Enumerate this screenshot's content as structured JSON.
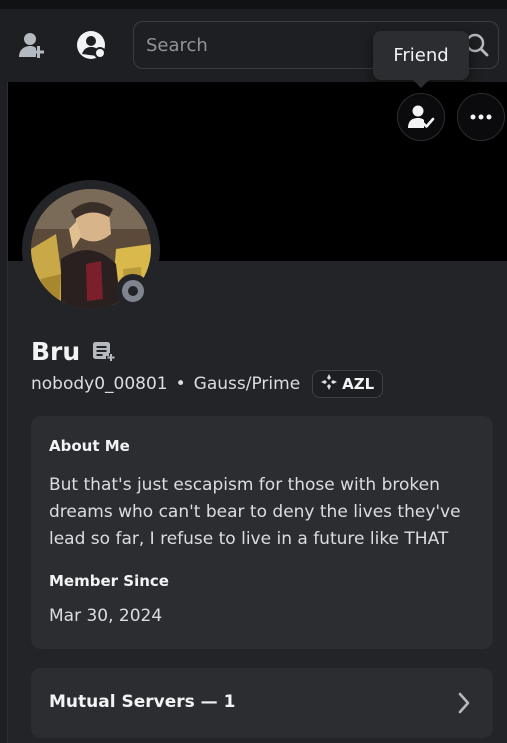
{
  "topbar": {
    "search_placeholder": "Search"
  },
  "tooltip": {
    "text": "Friend"
  },
  "profile": {
    "display_name": "Bru",
    "username": "nobody0_00801",
    "pronouns": "Gauss/Prime",
    "guild_tag": "AZL",
    "status": "offline",
    "about_heading": "About Me",
    "about_text": "But that's just escapism for those with broken dreams who can't bear to deny the lives they've lead so far, I refuse to live in a future like THAT",
    "member_since_heading": "Member Since",
    "member_since": "Mar 30, 2024",
    "mutual_servers_label": "Mutual Servers — 1"
  },
  "colors": {
    "background": "#1e1f22",
    "panel": "#232428",
    "card": "#2b2d31",
    "banner": "#000000",
    "status_offline": "#80848e"
  },
  "icons": [
    "add-friend-icon",
    "user-settings-icon",
    "search-icon",
    "friend-check-icon",
    "more-icon",
    "note-icon",
    "guild-tag-icon",
    "chevron-right-icon"
  ]
}
